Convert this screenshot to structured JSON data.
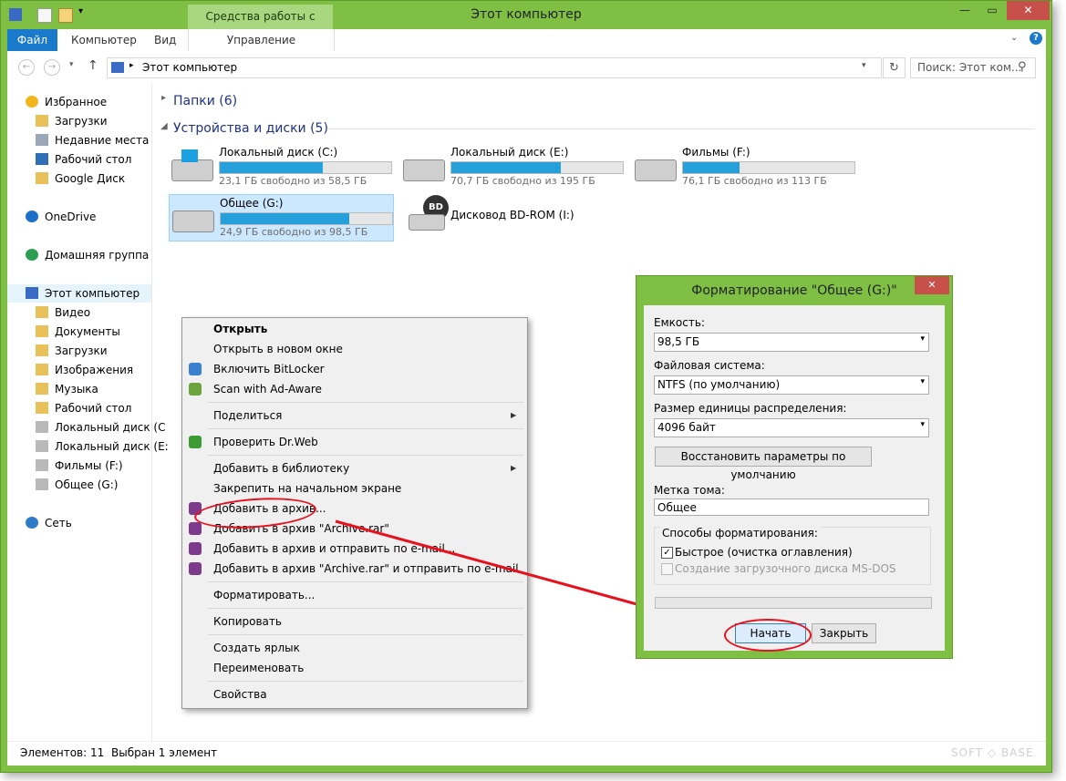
{
  "window": {
    "title": "Этот компьютер",
    "context_tab": "Средства работы с дисками",
    "minimize": "—",
    "maximize": "▭",
    "close": "✕"
  },
  "ribbon": {
    "tabs": [
      "Файл",
      "Компьютер",
      "Вид"
    ],
    "context_subtab": "Управление"
  },
  "address": {
    "path": "Этот компьютер",
    "search_placeholder": "Поиск: Этот ком..."
  },
  "nav": [
    {
      "label": "Избранное",
      "icon": "star-icon"
    },
    {
      "label": "Загрузки",
      "icon": "folder-icon"
    },
    {
      "label": "Недавние места",
      "icon": "recent-icon"
    },
    {
      "label": "Рабочий стол",
      "icon": "desktop-icon"
    },
    {
      "label": "Google Диск",
      "icon": "folder-icon"
    },
    {
      "label": "OneDrive",
      "icon": "cloud-icon"
    },
    {
      "label": "Домашняя группа",
      "icon": "homegroup-icon"
    },
    {
      "label": "Этот компьютер",
      "icon": "computer-icon"
    },
    {
      "label": "Видео",
      "icon": "folder-icon"
    },
    {
      "label": "Документы",
      "icon": "folder-icon"
    },
    {
      "label": "Загрузки",
      "icon": "folder-icon"
    },
    {
      "label": "Изображения",
      "icon": "folder-icon"
    },
    {
      "label": "Музыка",
      "icon": "folder-icon"
    },
    {
      "label": "Рабочий стол",
      "icon": "folder-icon"
    },
    {
      "label": "Локальный диск (C",
      "icon": "drive-icon"
    },
    {
      "label": "Локальный диск (E:",
      "icon": "drive-icon"
    },
    {
      "label": "Фильмы (F:)",
      "icon": "drive-icon"
    },
    {
      "label": "Общее (G:)",
      "icon": "drive-icon"
    },
    {
      "label": "Сеть",
      "icon": "network-icon"
    }
  ],
  "groups": {
    "folders": "Папки (6)",
    "devices": "Устройства и диски (5)"
  },
  "drives": [
    {
      "name": "Локальный диск (C:)",
      "free": "23,1 ГБ свободно из 58,5 ГБ",
      "used": 0.6
    },
    {
      "name": "Локальный диск (E:)",
      "free": "70,7 ГБ свободно из 195 ГБ",
      "used": 0.64
    },
    {
      "name": "Фильмы (F:)",
      "free": "76,1 ГБ свободно из 113 ГБ",
      "used": 0.33
    },
    {
      "name": "Общее (G:)",
      "free": "24,9 ГБ свободно из 98,5 ГБ",
      "used": 0.75
    },
    {
      "name": "Дисковод BD-ROM (I:)",
      "badge": "BD"
    }
  ],
  "context_menu": [
    "Открыть",
    "Открыть в новом окне",
    "Включить BitLocker",
    "Scan with Ad-Aware",
    "Поделиться",
    "Проверить Dr.Web",
    "Добавить в библиотеку",
    "Закрепить на начальном экране",
    "Добавить в архив...",
    "Добавить в архив \"Archive.rar\"",
    "Добавить в архив и отправить по e-mail...",
    "Добавить в архив \"Archive.rar\" и отправить по e-mail",
    "Форматировать...",
    "Копировать",
    "Создать ярлык",
    "Переименовать",
    "Свойства"
  ],
  "dialog": {
    "title": "Форматирование \"Общее (G:)\"",
    "capacity_label": "Емкость:",
    "capacity_value": "98,5 ГБ",
    "fs_label": "Файловая система:",
    "fs_value": "NTFS (по умолчанию)",
    "cluster_label": "Размер единицы распределения:",
    "cluster_value": "4096 байт",
    "restore_button": "Восстановить параметры по умолчанию",
    "volume_label": "Метка тома:",
    "volume_value": "Общее",
    "options_label": "Способы форматирования:",
    "quick_label": "Быстрое (очистка оглавления)",
    "msdos_label": "Создание загрузочного диска MS-DOS",
    "start_button": "Начать",
    "close_button": "Закрыть"
  },
  "status": {
    "items": "Элементов: 11",
    "selected": "Выбран 1 элемент",
    "watermark": "SOFT ◇ BASE"
  }
}
